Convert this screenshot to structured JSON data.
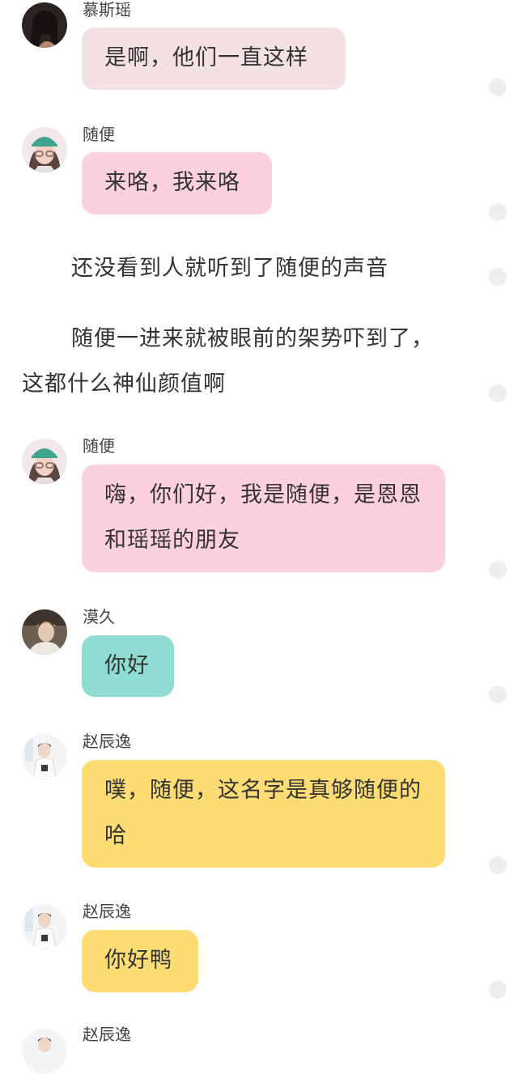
{
  "colors": {
    "bubble_pink_light": "#f3e1e3",
    "bubble_pink": "#fdd0dd",
    "bubble_teal": "#8fdcd3",
    "bubble_yellow": "#fedc74",
    "dot": "#eeeeee"
  },
  "messages": [
    {
      "sender": "慕斯瑶",
      "text": "是啊，他们一直这样",
      "avatar_icon": "avatar-female-dark-icon"
    },
    {
      "sender": "随便",
      "text": "来咯，我来咯",
      "avatar_icon": "avatar-girl-green-cap-icon"
    },
    {
      "sender": "随便",
      "text": "嗨，你们好，我是随便，是恩恩和瑶瑶的朋友",
      "avatar_icon": "avatar-girl-green-cap-icon"
    },
    {
      "sender": "漠久",
      "text": "你好",
      "avatar_icon": "avatar-boy-icon"
    },
    {
      "sender": "赵辰逸",
      "text": "噗，随便，这名字是真够随便的哈",
      "avatar_icon": "avatar-boy-white-shirt-icon"
    },
    {
      "sender": "赵辰逸",
      "text": "你好鸭",
      "avatar_icon": "avatar-boy-white-shirt-icon"
    },
    {
      "sender": "赵辰逸",
      "text": "",
      "avatar_icon": "avatar-boy-white-shirt-icon"
    }
  ],
  "narration": {
    "line1": "还没看到人就听到了随便的声音",
    "line2a": "随便一进来就被眼前的架势吓到了，",
    "line2b": "这都什么神仙颜值啊"
  }
}
